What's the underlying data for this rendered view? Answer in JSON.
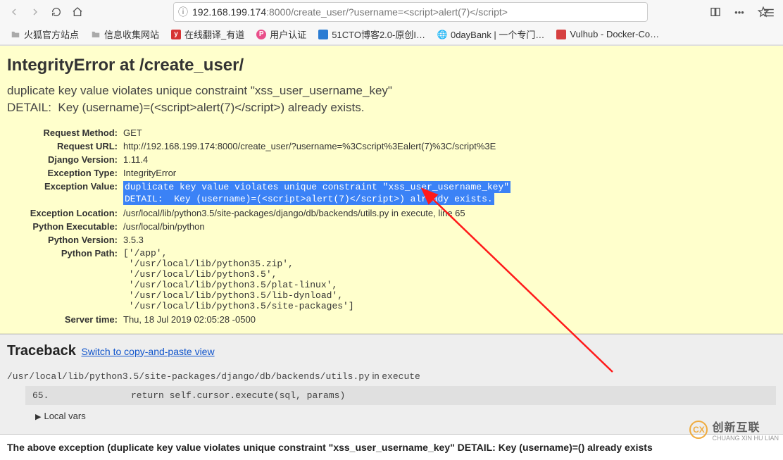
{
  "browser": {
    "url_host": "192.168.199.174",
    "url_port": ":8000",
    "url_path": "/create_user/?username=<script>alert(7)</script>",
    "bookmarks": [
      {
        "label": "火狐官方站点",
        "icon": "folder"
      },
      {
        "label": "信息收集网站",
        "icon": "folder"
      },
      {
        "label": "在线翻译_有道",
        "icon": "red-y"
      },
      {
        "label": "用户认证",
        "icon": "pink-p"
      },
      {
        "label": "51CTO博客2.0-原创I…",
        "icon": "blue-sq"
      },
      {
        "label": "0dayBank | 一个专门…",
        "icon": "globe"
      },
      {
        "label": "Vulhub - Docker-Co…",
        "icon": "vul"
      }
    ]
  },
  "django": {
    "title": "IntegrityError at /create_user/",
    "exception_message": "duplicate key value violates unique constraint \"xss_user_username_key\"\nDETAIL:  Key (username)=(<script>alert(7)</script>) already exists.",
    "rows": {
      "request_method": {
        "label": "Request Method:",
        "value": "GET"
      },
      "request_url": {
        "label": "Request URL:",
        "value": "http://192.168.199.174:8000/create_user/?username=%3Cscript%3Ealert(7)%3C/script%3E"
      },
      "django_version": {
        "label": "Django Version:",
        "value": "1.11.4"
      },
      "exception_type": {
        "label": "Exception Type:",
        "value": "IntegrityError"
      },
      "exception_value": {
        "label": "Exception Value:",
        "line1": "duplicate key value violates unique constraint \"xss_user_username_key\"",
        "line2": "DETAIL:  Key (username)=(<script>alert(7)</script>) already exists."
      },
      "exception_location": {
        "label": "Exception Location:",
        "value": "/usr/local/lib/python3.5/site-packages/django/db/backends/utils.py in execute, line 65"
      },
      "python_executable": {
        "label": "Python Executable:",
        "value": "/usr/local/bin/python"
      },
      "python_version": {
        "label": "Python Version:",
        "value": "3.5.3"
      },
      "python_path": {
        "label": "Python Path:",
        "value": "['/app',\n '/usr/local/lib/python35.zip',\n '/usr/local/lib/python3.5',\n '/usr/local/lib/python3.5/plat-linux',\n '/usr/local/lib/python3.5/lib-dynload',\n '/usr/local/lib/python3.5/site-packages']"
      },
      "server_time": {
        "label": "Server time:",
        "value": "Thu, 18 Jul 2019 02:05:28 -0500"
      }
    }
  },
  "traceback": {
    "heading": "Traceback",
    "switch": "Switch to copy-and-paste view",
    "file_line": "/usr/local/lib/python3.5/site-packages/django/db/backends/utils.py",
    "file_in": " in ",
    "file_func": "execute",
    "code_lineno": "65.",
    "code_text": "return self.cursor.execute(sql, params)",
    "local_vars": "Local vars"
  },
  "footer": {
    "text": "The above exception (duplicate key value violates unique constraint \"xss_user_username_key\" DETAIL: Key (username)=() already exists"
  },
  "watermark": {
    "logo_text": "CX",
    "text": "创新互联",
    "sub": "CHUANG XIN HU LIAN"
  }
}
